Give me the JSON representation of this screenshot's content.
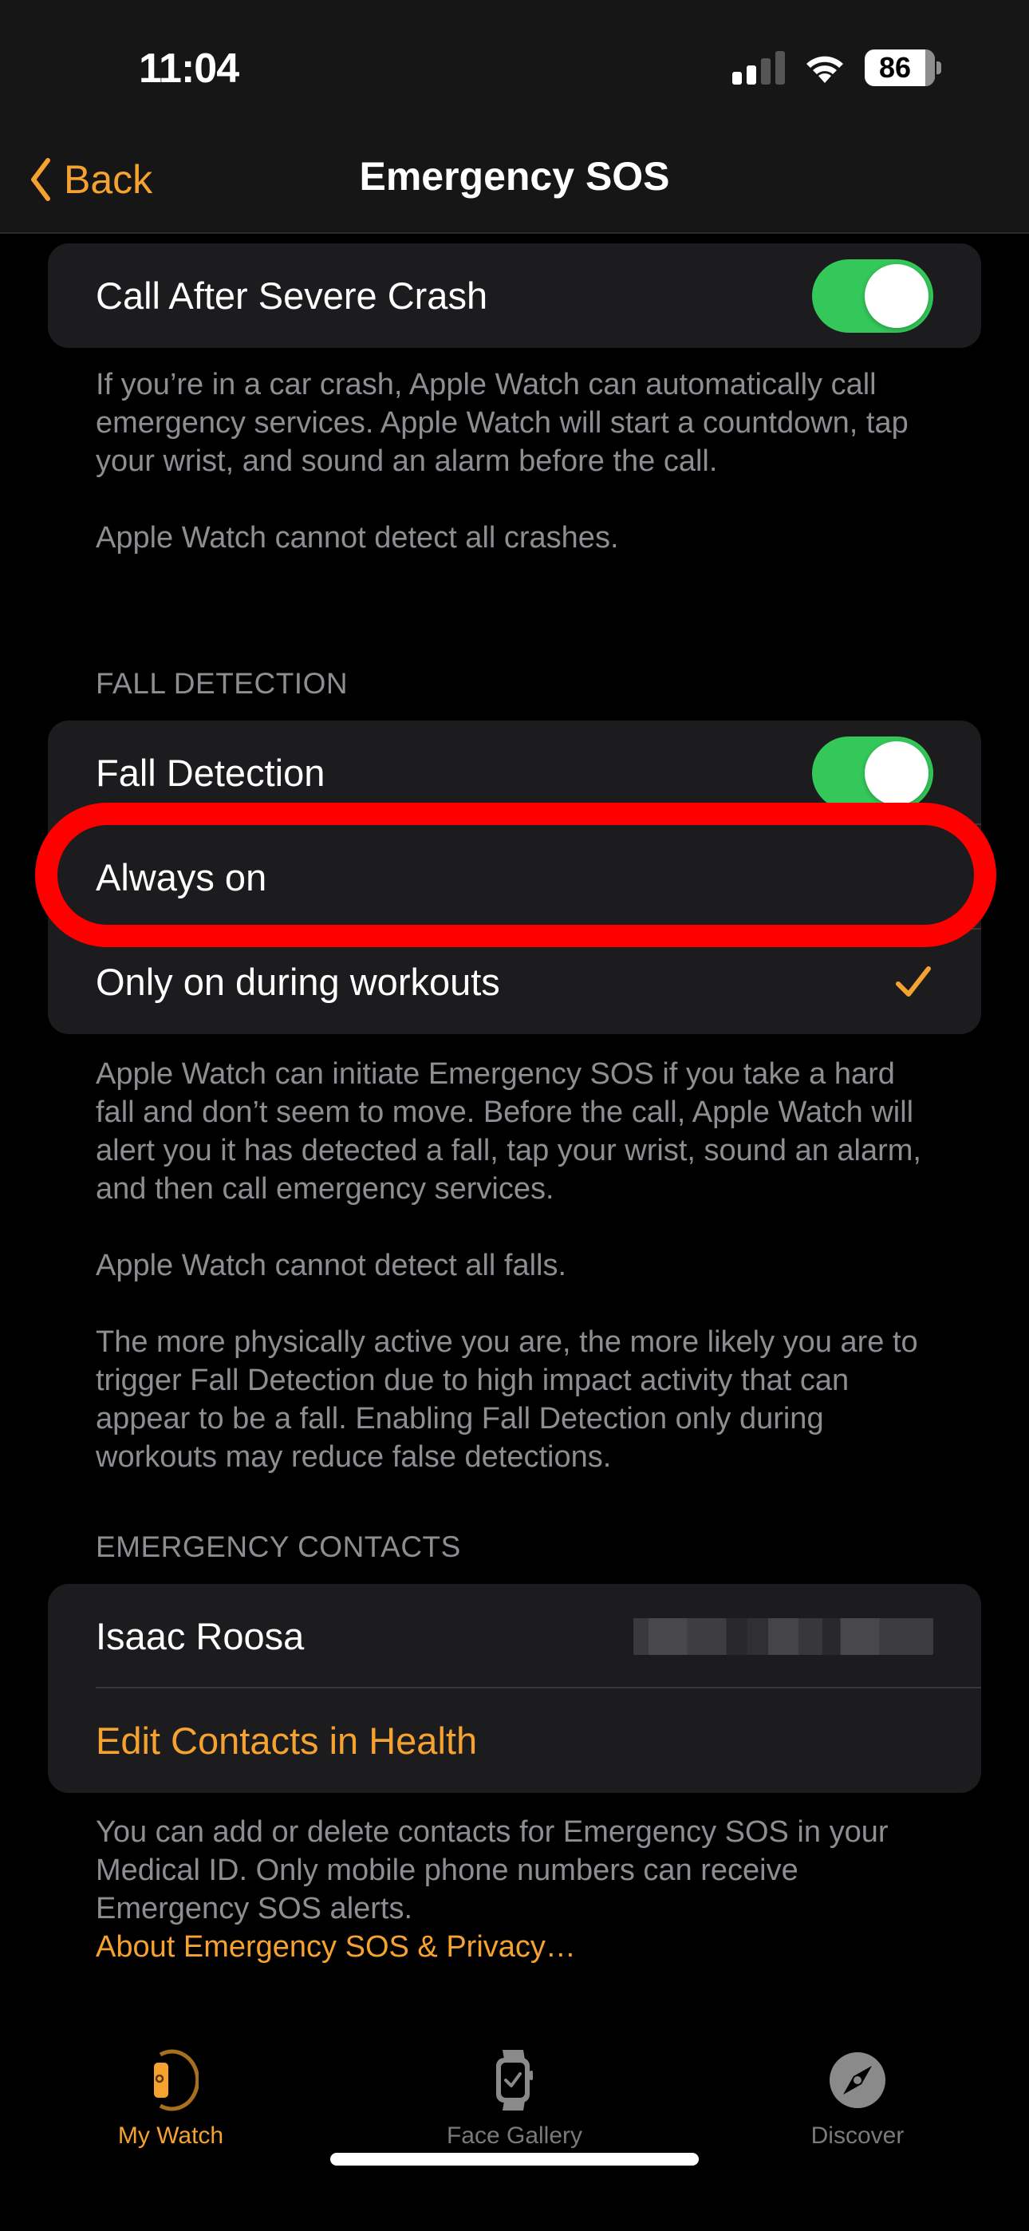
{
  "status_bar": {
    "time": "11:04",
    "signal_bars_active": 2,
    "signal_bars_total": 4,
    "wifi_icon": "wifi-icon",
    "battery_level": 86,
    "battery_label": "86"
  },
  "nav": {
    "back_label": "Back",
    "back_icon": "chevron-left-icon",
    "title": "Emergency SOS"
  },
  "crash_section": {
    "toggle_label": "Call After Severe Crash",
    "toggle_on": true,
    "footer": [
      "If you’re in a car crash, Apple Watch can automatically call emergency services. Apple Watch will start a countdown, tap your wrist, and sound an alarm before the call.",
      "Apple Watch cannot detect all crashes."
    ]
  },
  "fall_section": {
    "header": "FALL DETECTION",
    "toggle_label": "Fall Detection",
    "toggle_on": true,
    "options": [
      {
        "label": "Always on",
        "selected": false,
        "highlighted": true
      },
      {
        "label": "Only on during workouts",
        "selected": true,
        "highlighted": false
      }
    ],
    "checkmark_icon": "checkmark-icon",
    "footer": [
      "Apple Watch can initiate Emergency SOS if you take a hard fall and don’t seem to move. Before the call, Apple Watch will alert you it has detected a fall, tap your wrist, sound an alarm, and then call emergency services.",
      "Apple Watch cannot detect all falls.",
      "The more physically active you are, the more likely you are to trigger Fall Detection due to high impact activity that can appear to be a fall. Enabling Fall Detection only during workouts may reduce false detections."
    ]
  },
  "contacts_section": {
    "header": "EMERGENCY CONTACTS",
    "contact_name": "Isaac Roosa",
    "contact_number_redacted": true,
    "edit_link": "Edit Contacts in Health",
    "footer": "You can add or delete contacts for Emergency SOS in your Medical ID. Only mobile phone numbers can receive Emergency SOS alerts.",
    "privacy_link": "About Emergency SOS & Privacy…"
  },
  "tab_bar": {
    "tabs": [
      {
        "label": "My Watch",
        "icon": "my-watch-icon",
        "active": true
      },
      {
        "label": "Face Gallery",
        "icon": "face-gallery-icon",
        "active": false
      },
      {
        "label": "Discover",
        "icon": "compass-icon",
        "active": false
      }
    ]
  },
  "colors": {
    "accent": "#f5a230",
    "toggle_on": "#34c759",
    "card_bg": "#1c1c1e",
    "secondary_text": "#8d8d92",
    "annotation": "#ff0000"
  }
}
